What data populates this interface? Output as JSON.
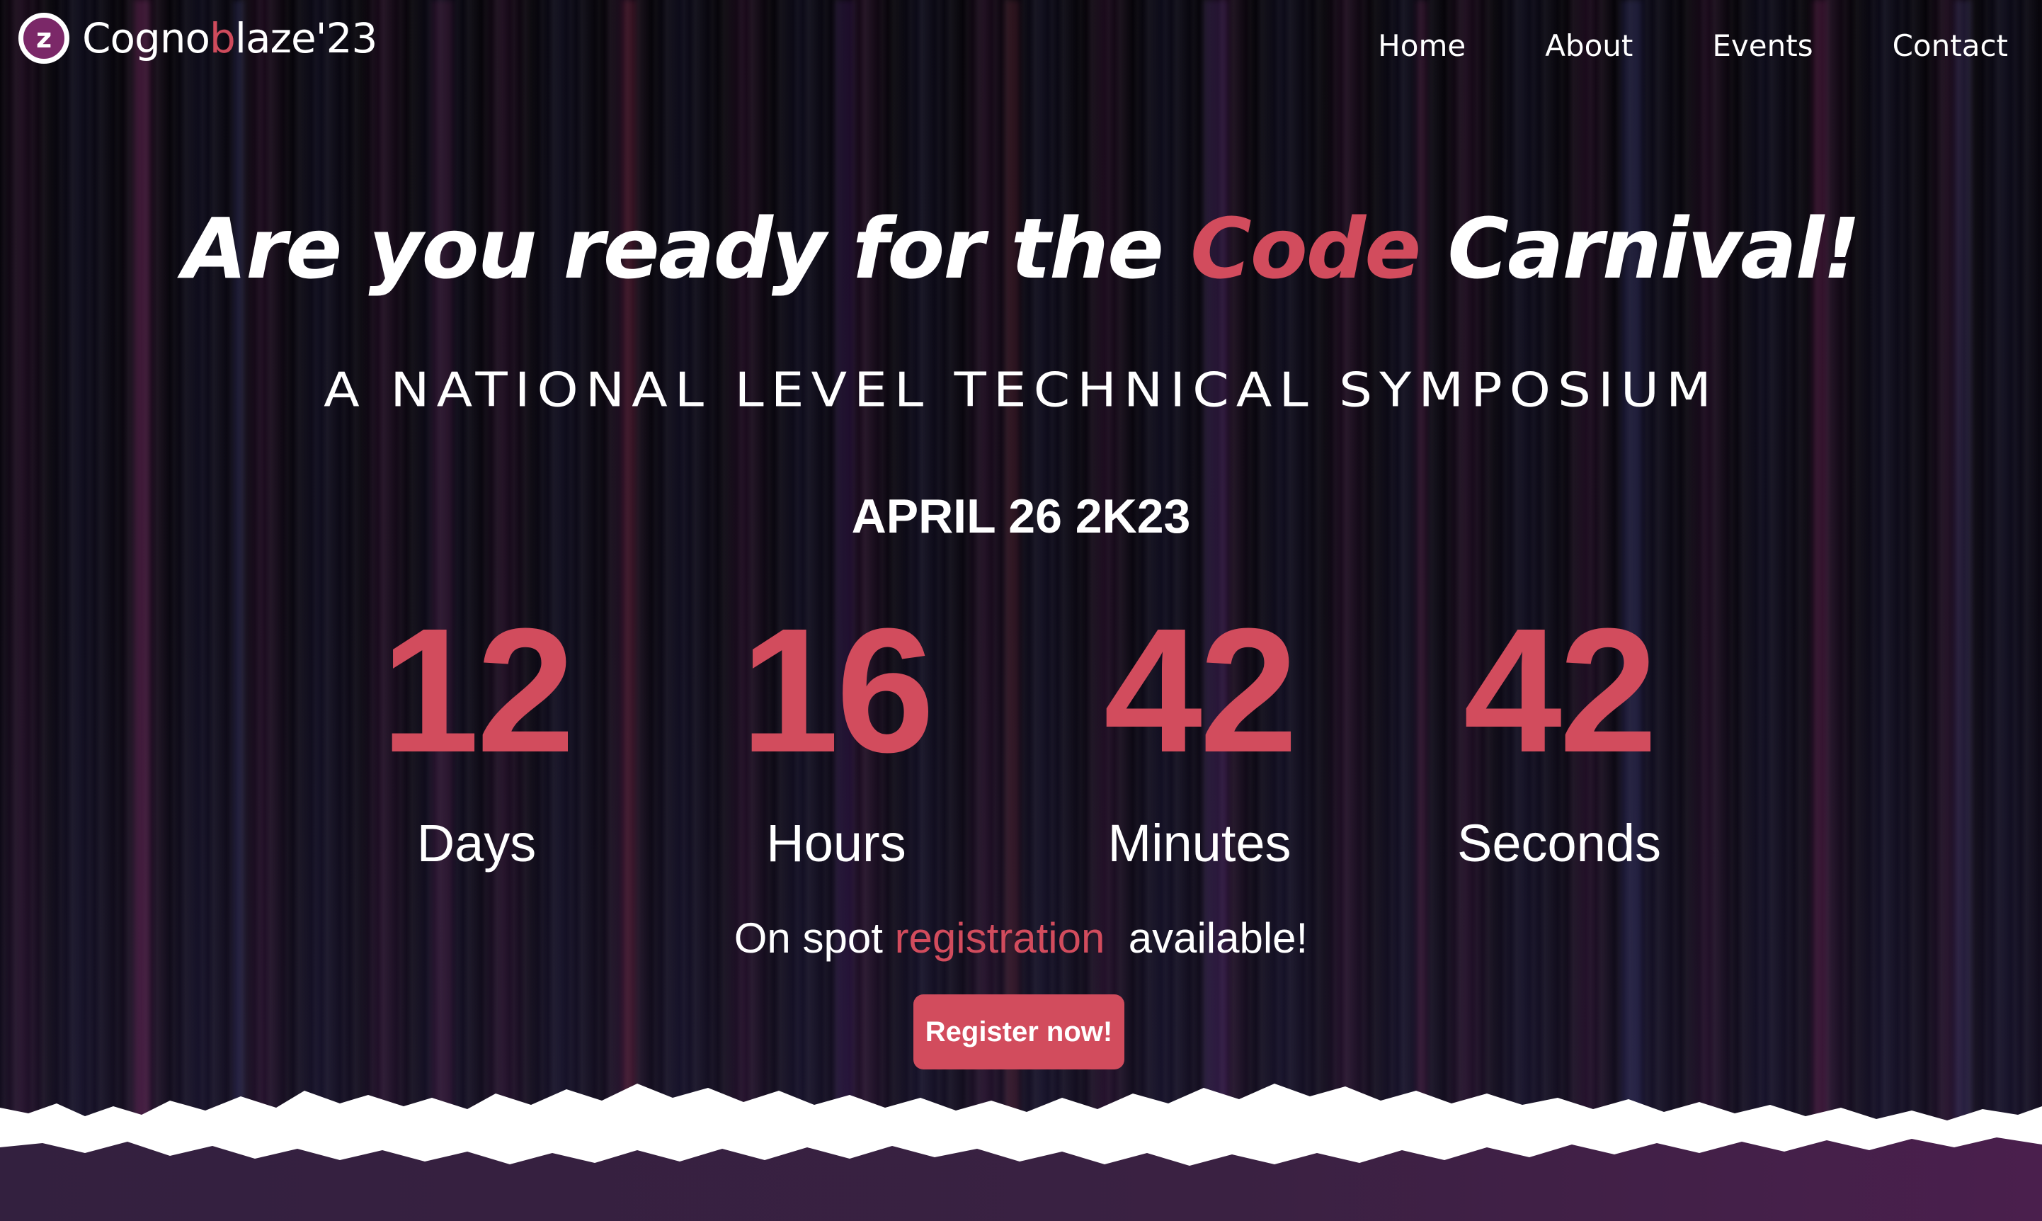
{
  "nav": {
    "logo": {
      "mark_letter": "z",
      "text_prefix": "Cogno",
      "text_highlight": "b",
      "text_suffix": "laze'23"
    },
    "links": [
      "Home",
      "About",
      "Events",
      "Contact"
    ]
  },
  "hero": {
    "title_before": "Are you ready for the ",
    "title_accent": "Code",
    "title_after": " Carnival!",
    "subtitle": "A NATIONAL LEVEL TECHNICAL SYMPOSIUM",
    "date": "APRIL 26 2K23"
  },
  "countdown": [
    {
      "value": "12",
      "label": "Days"
    },
    {
      "value": "16",
      "label": "Hours"
    },
    {
      "value": "42",
      "label": "Minutes"
    },
    {
      "value": "42",
      "label": "Seconds"
    }
  ],
  "registration": {
    "text_before": "On spot ",
    "link_text": "registration",
    "text_after": "  available!",
    "button_label": "Register now!"
  },
  "colors": {
    "accent": "#d24c5d",
    "background": "#050308",
    "footer_band": "#3a1f44"
  }
}
